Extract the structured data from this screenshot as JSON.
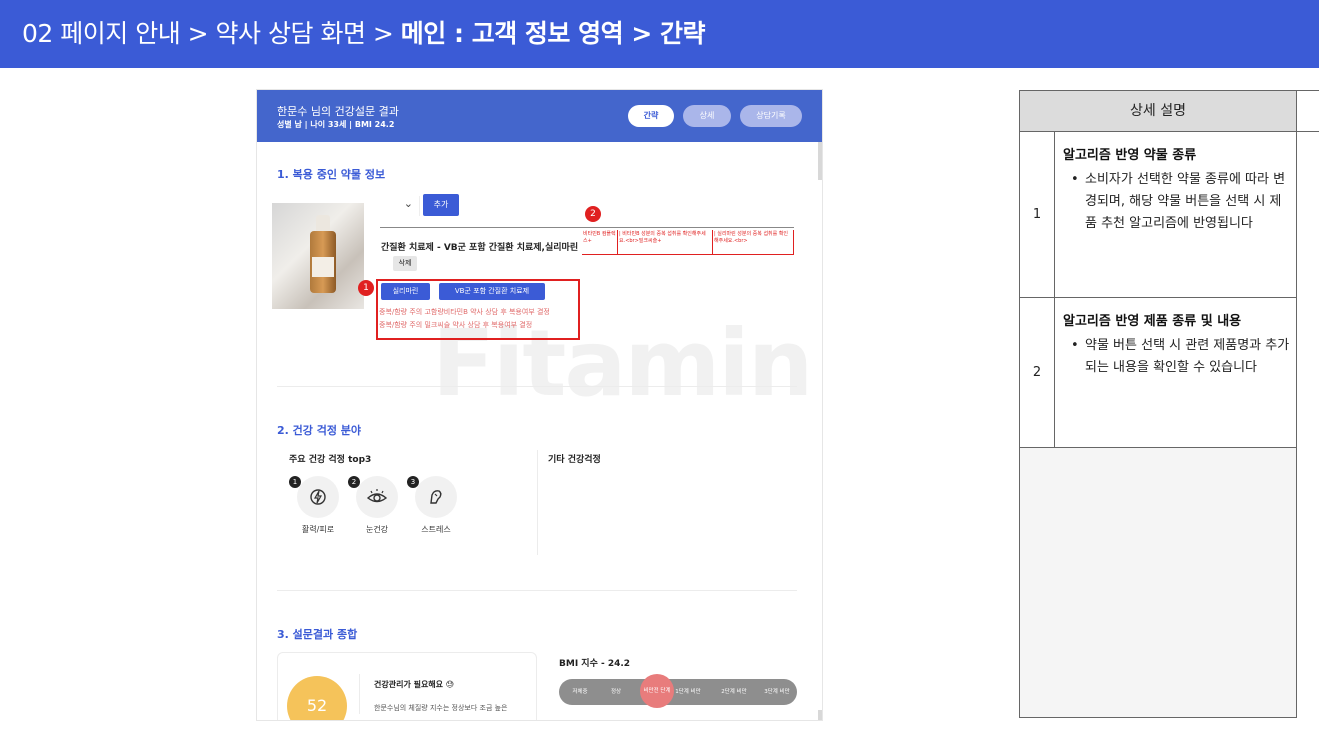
{
  "header": {
    "prefix": "02 페이지 안내 > 약사 상담 화면 >",
    "bold": "메인 : 고객 정보 영역 > 간략"
  },
  "app": {
    "customer_name": "한문수 님의 건강설문 결과",
    "meta": "성별 남 | 나이 33세 | BMI 24.2",
    "tabs": [
      "간략",
      "상세",
      "상담기록"
    ],
    "watermark": "Fitamin"
  },
  "section1": {
    "title": "1. 복용 중인 약물 정보",
    "add_label": "추가",
    "selected": "간질환 치료제 - VB군 포함 간질환 치료제,실리마린",
    "delete_label": "삭제",
    "drug_buttons": [
      "실리마린",
      "VB군 포함 간질환 치료제"
    ],
    "warnings": [
      "중복/함량 주의 고함량비타민B 약사 상담 후 복용여부 결정",
      "중복/함량 주의 밀크씨슬 약사 상담 후 복용여부 결정"
    ],
    "products": [
      "비타민B 컴플렉스+",
      "| 비타민B 성분의 중복 섭취를 확인해주세요.<br>밀크씨슬+",
      "| 실리마린 성분의 중복 섭취를 확인해주세요.<br>"
    ]
  },
  "section2": {
    "title": "2. 건강 걱정 분야",
    "top3_label": "주요 건강 걱정 top3",
    "other_label": "기타 건강걱정",
    "items": [
      {
        "num": "1",
        "label": "활력/피로",
        "icon": "energy-icon"
      },
      {
        "num": "2",
        "label": "눈건강",
        "icon": "eye-icon"
      },
      {
        "num": "3",
        "label": "스트레스",
        "icon": "stress-icon"
      }
    ]
  },
  "section3": {
    "title": "3. 설문결과 종합",
    "score": "52",
    "headline": "건강관리가 필요해요 😓",
    "body": "한문수님의 체질량 지수는 정상보다 조금 높은",
    "bmi_title": "BMI 지수 - 24.2",
    "bmi_segments": [
      "저체중",
      "정상",
      "비만전 단계",
      "1단계 비만",
      "2단계 비만",
      "3단계 비만"
    ],
    "bmi_active_index": 2
  },
  "badges": [
    "1",
    "2"
  ],
  "panel": {
    "title": "상세 설명",
    "rows": [
      {
        "num": "1",
        "title": "알고리즘 반영 약물 종류",
        "bullet": "소비자가 선택한 약물 종류에 따라 변경되며, 해당 약물 버튼을 선택 시 제품 추천 알고리즘에 반영됩니다"
      },
      {
        "num": "2",
        "title": "알고리즘 반영 제품 종류 및 내용",
        "bullet": "약물 버튼 선택 시 관련 제품명과 추가되는 내용을 확인할 수 있습니다"
      }
    ]
  },
  "colors": {
    "brand_blue": "#3b5bd6",
    "annotation_red": "#e02020"
  }
}
